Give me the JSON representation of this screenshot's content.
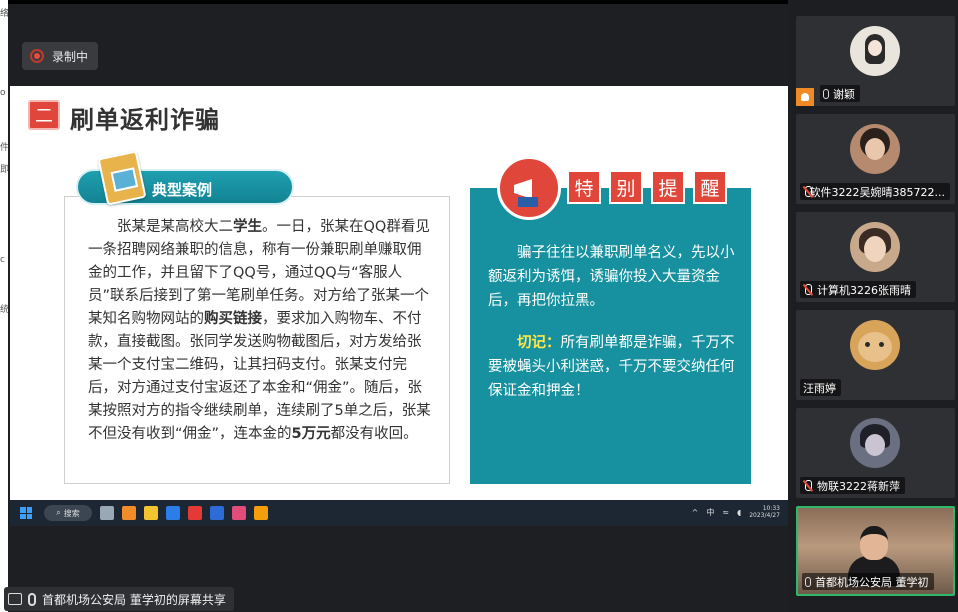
{
  "meeting": {
    "recording_label": "录制中",
    "presenter_label": "首都机场公安局 董学初的屏幕共享"
  },
  "slide": {
    "section_number": "二",
    "title": "刷单返利诈骗",
    "case_tab_label": "典型案例",
    "case_text_1": "张某是某高校大二",
    "case_text_bold_1": "学生",
    "case_text_2": "。一日，张某在QQ群看见一条招聘网络兼职的信息，称有一份兼职刷单赚取佣金的工作，并且留下了QQ号，通过QQ与“客服人员”联系后接到了第一笔刷单任务。对方给了张某一个某知名购物网站的",
    "case_text_bold_2": "购买链接",
    "case_text_3": "，要求加入购物车、不付款，直接截图。张同学发送购物截图后，对方发给张某一个支付宝二维码，让其扫码支付。张某支付完后，对方通过支付宝返还了本金和“佣金”。随后，张某按照对方的指令继续刷单，连续刷了5单之后，张某不但没有收到“佣金”，连本金的",
    "case_text_bold_3": "5万元",
    "case_text_4": "都没有收回。",
    "warning_chars": [
      "特",
      "别",
      "提",
      "醒"
    ],
    "warning_text_1": "骗子往往以兼职刷单名义，先以小额返利为诱饵，诱骗你投入大量资金后，再把你拉黑。",
    "warning_highlight": "切记：",
    "warning_text_2": "所有刷单都是诈骗，千万不要被蝇头小利迷惑，千万不要交纳任何保证金和押金！"
  },
  "taskbar": {
    "search_label": "搜索",
    "tray_input": "中",
    "time": "10:33",
    "date": "2023/4/27",
    "app_colors": [
      "#9aa7b5",
      "#f28c28",
      "#f4c430",
      "#2b7de9",
      "#e53935",
      "#2c6bd8",
      "#e24c7a",
      "#f59e0b"
    ]
  },
  "participants": [
    {
      "name": "谢颖",
      "mic": "on",
      "host": true,
      "avatar_color": "#e9e4dc"
    },
    {
      "name": "软件3222吴婉晴385722...",
      "mic": "off",
      "avatar_color": "#b58a6e"
    },
    {
      "name": "计算机3226张雨晴",
      "mic": "off",
      "avatar_color": "#c9a98c"
    },
    {
      "name": "汪雨婷",
      "mic": "none",
      "avatar_color": "#d8a45a"
    },
    {
      "name": "物联3222蒋新萍",
      "mic": "off",
      "avatar_color": "#6a6f82"
    },
    {
      "name": "首都机场公安局 董学初",
      "mic": "on",
      "video": true
    }
  ]
}
